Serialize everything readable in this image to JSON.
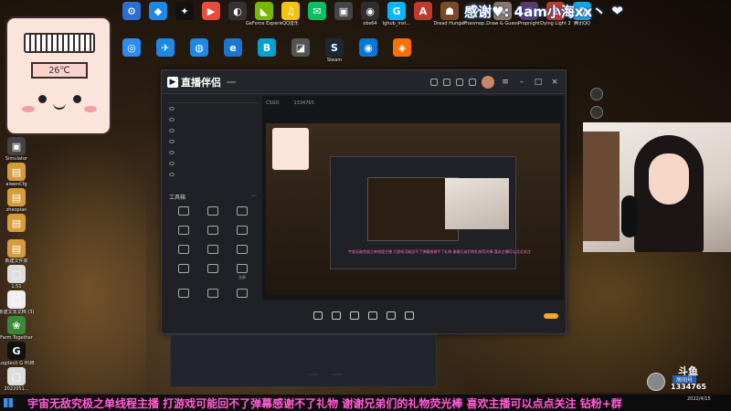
{
  "desktop": {
    "top_icons": [
      {
        "label": "",
        "color": "#2b6fd1",
        "glyph": "⚙"
      },
      {
        "label": "",
        "color": "#1e88e5",
        "glyph": "◆"
      },
      {
        "label": "",
        "color": "#111111",
        "glyph": "✦"
      },
      {
        "label": "",
        "color": "#e74c3c",
        "glyph": "▶"
      },
      {
        "label": "",
        "color": "#333333",
        "glyph": "◐"
      },
      {
        "label": "GeForce Experience",
        "color": "#76b900",
        "glyph": "◣"
      },
      {
        "label": "QQ音乐",
        "color": "#f1c40f",
        "glyph": "♫"
      },
      {
        "label": "",
        "color": "#07c160",
        "glyph": "✉"
      },
      {
        "label": "",
        "color": "#444444",
        "glyph": "▣"
      },
      {
        "label": "obs64",
        "color": "#302e31",
        "glyph": "◉"
      },
      {
        "label": "lghub_inst...",
        "color": "#00b8fc",
        "glyph": "G"
      },
      {
        "label": "",
        "color": "#c0392b",
        "glyph": "A"
      },
      {
        "label": "Dread Hunger",
        "color": "#7b4a2b",
        "glyph": "☗"
      },
      {
        "label": "Phasmop...",
        "color": "#222222",
        "glyph": "P"
      },
      {
        "label": "Draw & Guess",
        "color": "#8a7a6a",
        "glyph": "✎"
      },
      {
        "label": "Propnight",
        "color": "#5a3a6a",
        "glyph": "☠"
      },
      {
        "label": "Dying Light 2",
        "color": "#c0392b",
        "glyph": "2"
      },
      {
        "label": "腾讯QQ",
        "color": "#1aa1e6",
        "glyph": "Q"
      }
    ],
    "second_row_icons": [
      {
        "label": "",
        "color": "#2d8cf0",
        "glyph": "◎"
      },
      {
        "label": "",
        "color": "#1e88e5",
        "glyph": "✈"
      },
      {
        "label": "",
        "color": "#1e88e5",
        "glyph": "◍"
      },
      {
        "label": "",
        "color": "#1976d2",
        "glyph": "e"
      },
      {
        "label": "",
        "color": "#00a1d6",
        "glyph": "B"
      },
      {
        "label": "",
        "color": "#555555",
        "glyph": "◪"
      },
      {
        "label": "Steam",
        "color": "#1b2838",
        "glyph": "S"
      },
      {
        "label": "",
        "color": "#0078d7",
        "glyph": "◉"
      },
      {
        "label": "",
        "color": "#ff6f00",
        "glyph": "◈"
      }
    ],
    "left_icons": [
      {
        "label": "Simulator",
        "color": "#444444",
        "glyph": "▣"
      },
      {
        "label": "aiwenCfg",
        "color": "#d69b3a",
        "glyph": "▤"
      },
      {
        "label": "zhaopian",
        "color": "#d69b3a",
        "glyph": "▤"
      },
      {
        "label": "",
        "color": "#d69b3a",
        "glyph": "▤"
      },
      {
        "label": "新建文件夹",
        "color": "#d69b3a",
        "glyph": "▤"
      },
      {
        "label": "1:51",
        "color": "#dddddd",
        "glyph": "▢"
      },
      {
        "label": "新建文本文档 (3)",
        "color": "#eeeeee",
        "glyph": "▢"
      },
      {
        "label": "Farm Together",
        "color": "#3a8a3a",
        "glyph": "❀"
      },
      {
        "label": "Logitech G HUB",
        "color": "#111111",
        "glyph": "G"
      },
      {
        "label": "2022051...",
        "color": "#dddddd",
        "glyph": "▢"
      }
    ]
  },
  "mascot": {
    "temperature": "26℃"
  },
  "overlay": {
    "thanks_text": "感谢♥: 4am小海xx丶",
    "heart": "❤",
    "ticker": "宇宙无敌究极之单线程主播 打游戏可能回不了弹幕感谢不了礼物 谢谢兄弟们的礼物荧光棒 喜欢主播可以点点关注 钻粉+群",
    "logo_brand": "斗鱼",
    "logo_room_label": "房间号",
    "logo_room_number": "1334765",
    "tray_time": "",
    "tray_date": "2022/4/15"
  },
  "app": {
    "brand": "直播伴侣",
    "version_badge": "",
    "side_tabs": [
      "",
      "",
      ""
    ],
    "scenes": [
      "",
      "",
      "",
      "",
      "",
      "",
      ""
    ],
    "tools_title": "工具箱",
    "tools": [
      "",
      "",
      "",
      "",
      "",
      "",
      "",
      "",
      "",
      "",
      "",
      "全屏",
      "",
      "",
      ""
    ],
    "stream_title": "",
    "stream_tags": [
      "CSGO",
      "",
      "1334765",
      ""
    ],
    "bottom_items": [
      "",
      "",
      "",
      "",
      "",
      ""
    ],
    "start_label": ""
  },
  "subwindow": {
    "status": "",
    "btn_a": "",
    "btn_b": ""
  },
  "colors": {
    "accent": "#f5a623",
    "ticker": "#ff5fd0",
    "thanks_glow": "#3a6fd8",
    "taskbar_blue": "#3a8ee6"
  }
}
